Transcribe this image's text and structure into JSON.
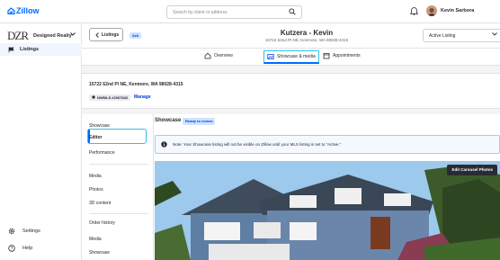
{
  "topbar": {
    "logo_text": "Zillow",
    "search_placeholder": "Search by client or address",
    "user_name": "Kevin Sarbora"
  },
  "sidebar": {
    "org_logo": "DZR",
    "org_name": "Designed Realty",
    "nav_listings": "Listings",
    "settings": "Settings",
    "help": "Help"
  },
  "header": {
    "back_label": "Listings",
    "sell_badge": "Sell",
    "title": "Kutzera - Kevin",
    "subtitle": "15722 62nd PI NE, Kenmore, WA 98028-4315",
    "status_value": "Active Listing"
  },
  "tabs": [
    {
      "label": "Overview",
      "icon": "house-icon"
    },
    {
      "label": "Showcase & media",
      "icon": "media-icon"
    },
    {
      "label": "Appointments",
      "icon": "calendar-icon"
    }
  ],
  "address_card": {
    "address": "15722 62nd Pl NE, Kenmore, WA 98028-4315",
    "mls_badge": "NWMLS #2067843",
    "manage": "Manage"
  },
  "left_panel": {
    "showcase": "Showcase",
    "editor": "Editor",
    "performance": "Performance",
    "media": "Media",
    "photos": "Photos",
    "content_3d": "3D content",
    "order_history": "Order history",
    "media2": "Media",
    "showcase2": "Showcase"
  },
  "main": {
    "title": "Showcase",
    "ready_badge": "Ready to review",
    "note": "Note: Your Showcase listing will not be visible on Zillow until your MLS listing is set to \"Active.\"",
    "edit_carousel": "Edit Carousel Photos"
  },
  "colors": {
    "accent": "#006aff",
    "highlight": "#2fc2e6"
  }
}
